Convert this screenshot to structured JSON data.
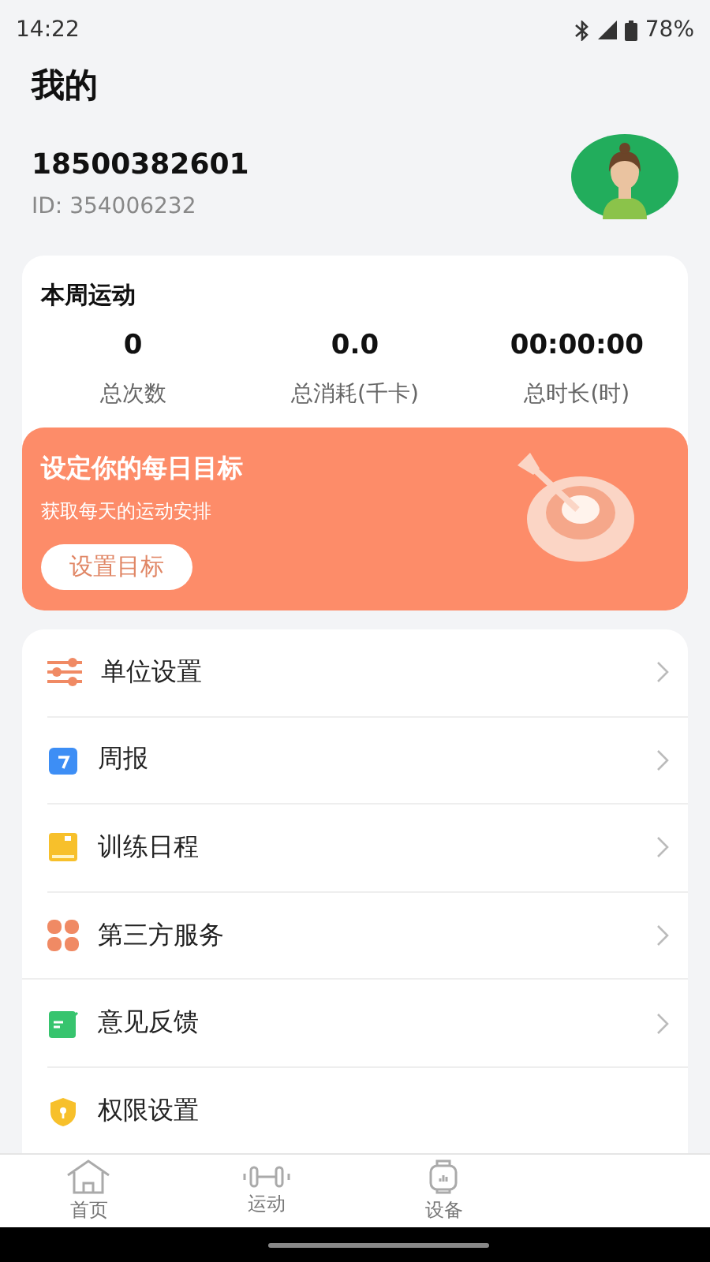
{
  "status_bar": {
    "time": "14:22",
    "battery": "78%"
  },
  "header": {
    "title": "我的"
  },
  "profile": {
    "phone": "18500382601",
    "id": "ID: 354006232"
  },
  "weekly": {
    "title": "本周运动",
    "stats": [
      {
        "value": "0",
        "label": "总次数"
      },
      {
        "value": "0.0",
        "label": "总消耗(千卡)"
      },
      {
        "value": "00:00:00",
        "label": "总时长(时)"
      }
    ]
  },
  "goal_banner": {
    "title": "设定你的每日目标",
    "subtitle": "获取每天的运动安排",
    "button": "设置目标"
  },
  "menu": [
    {
      "kind": "sliders",
      "label": "单位设置",
      "chevron": true
    },
    {
      "kind": "calendar",
      "label": "周报",
      "chevron": true
    },
    {
      "kind": "book",
      "label": "训练日程",
      "chevron": true
    },
    {
      "kind": "clover",
      "label": "第三方服务",
      "chevron": true
    },
    {
      "kind": "feedback",
      "label": "意见反馈",
      "chevron": true
    },
    {
      "kind": "shield",
      "label": "权限设置",
      "chevron": false
    }
  ],
  "tab_bar": [
    {
      "kind": "home",
      "label": "首页",
      "selected": false
    },
    {
      "kind": "dumbbell",
      "label": "运动",
      "selected": false
    },
    {
      "kind": "watch",
      "label": "设备",
      "selected": false
    }
  ]
}
